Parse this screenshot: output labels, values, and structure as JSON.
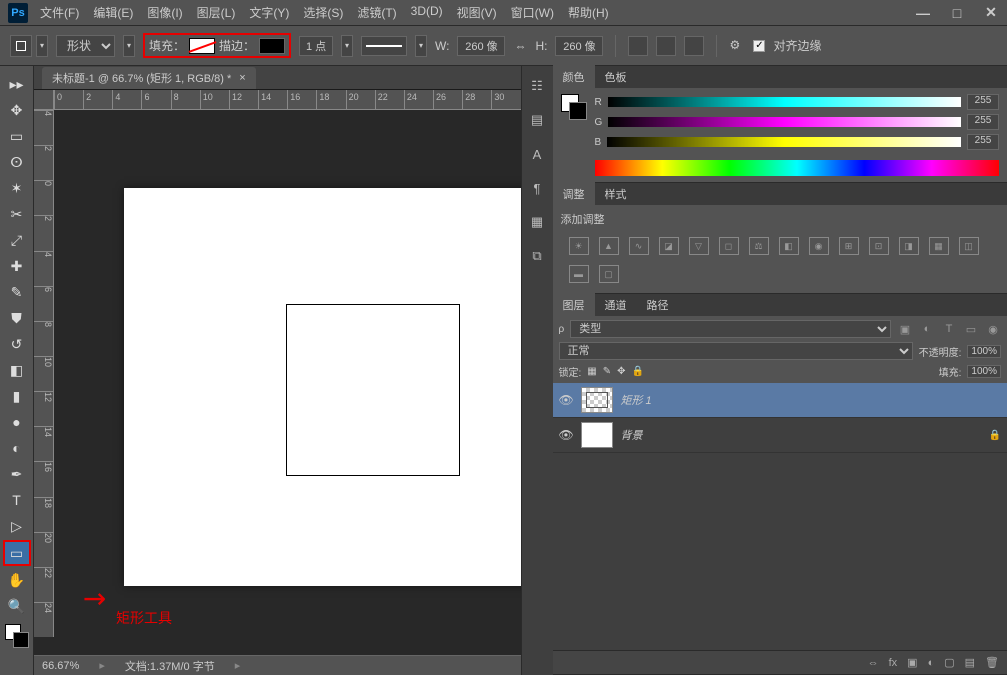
{
  "app_logo": "Ps",
  "menu": [
    "文件(F)",
    "编辑(E)",
    "图像(I)",
    "图层(L)",
    "文字(Y)",
    "选择(S)",
    "滤镜(T)",
    "3D(D)",
    "视图(V)",
    "窗口(W)",
    "帮助(H)"
  ],
  "options": {
    "shape_mode": "形状",
    "fill_label": "填充：",
    "stroke_label": "描边：",
    "stroke_width": "1 点",
    "w_label": "W:",
    "w_value": "260 像",
    "h_label": "H:",
    "h_value": "260 像",
    "align_edges": "对齐边缘"
  },
  "document": {
    "tab_title": "未标题-1 @ 66.7% (矩形 1, RGB/8) *",
    "ruler_h": [
      "0",
      "2",
      "4",
      "6",
      "8",
      "10",
      "12",
      "14",
      "16",
      "18",
      "20",
      "22",
      "24",
      "26",
      "28",
      "30"
    ],
    "ruler_v": [
      "4",
      "2",
      "0",
      "2",
      "4",
      "6",
      "8",
      "10",
      "12",
      "14",
      "16",
      "18",
      "20",
      "22",
      "24"
    ],
    "zoom": "66.67%",
    "doc_info": "文档:1.37M/0 字节"
  },
  "annotation": {
    "label": "矩形工具"
  },
  "panels": {
    "color": {
      "tabs": [
        "颜色",
        "色板"
      ],
      "channels": [
        {
          "label": "R",
          "value": "255"
        },
        {
          "label": "G",
          "value": "255"
        },
        {
          "label": "B",
          "value": "255"
        }
      ]
    },
    "adjust": {
      "tabs": [
        "调整",
        "样式"
      ],
      "title": "添加调整"
    },
    "layers": {
      "tabs": [
        "图层",
        "通道",
        "路径"
      ],
      "kind": "类型",
      "blend": "正常",
      "opacity_label": "不透明度:",
      "opacity": "100%",
      "lock_label": "锁定:",
      "fill_label": "填充:",
      "fill": "100%",
      "items": [
        {
          "name": "矩形 1"
        },
        {
          "name": "背景"
        }
      ]
    }
  }
}
